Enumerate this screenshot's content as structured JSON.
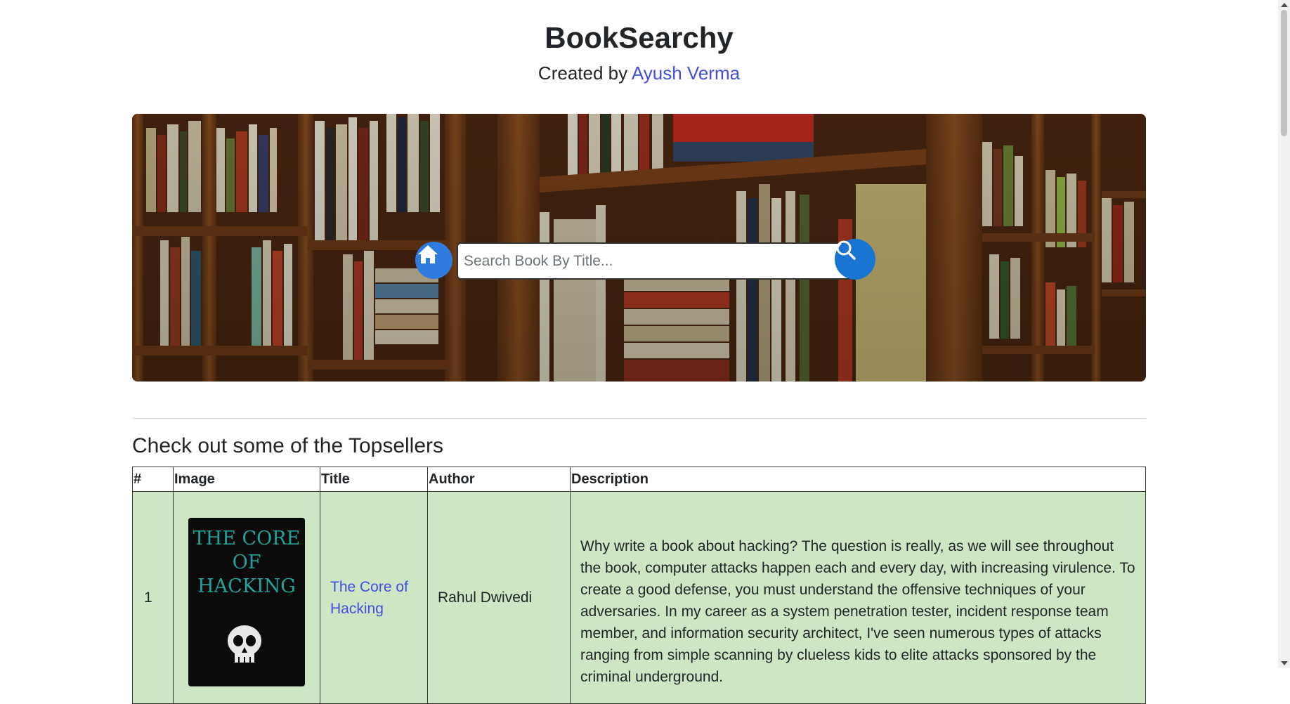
{
  "header": {
    "title": "BookSearchy",
    "created_by_prefix": "Created by",
    "author_link": "Ayush Verma"
  },
  "search": {
    "placeholder": "Search Book By Title...",
    "value": ""
  },
  "icons": {
    "home": "home-icon",
    "search": "search-icon"
  },
  "section": {
    "heading": "Check out some of the Topsellers"
  },
  "table": {
    "headers": [
      "#",
      "Image",
      "Title",
      "Author",
      "Description"
    ],
    "rows": [
      {
        "num": "1",
        "cover_text": "The Core of Hacking",
        "title": "The Core of Hacking",
        "author": "Rahul Dwivedi",
        "description": "Why write a book about hacking? The question is really, as we will see throughout the book, computer attacks happen each and every day, with increasing virulence. To create a good defense, you must understand the offensive techniques of your adversaries. In my career as a system penetration tester, incident response team member, and information security architect, I've seen numerous types of attacks ranging from simple scanning by clueless kids to elite attacks sponsored by the criminal underground."
      }
    ]
  },
  "colors": {
    "link": "#3f4ee0",
    "row_bg": "#cfe6c4",
    "search_button": "#1a74d1",
    "home_button": "#2f7be0"
  }
}
